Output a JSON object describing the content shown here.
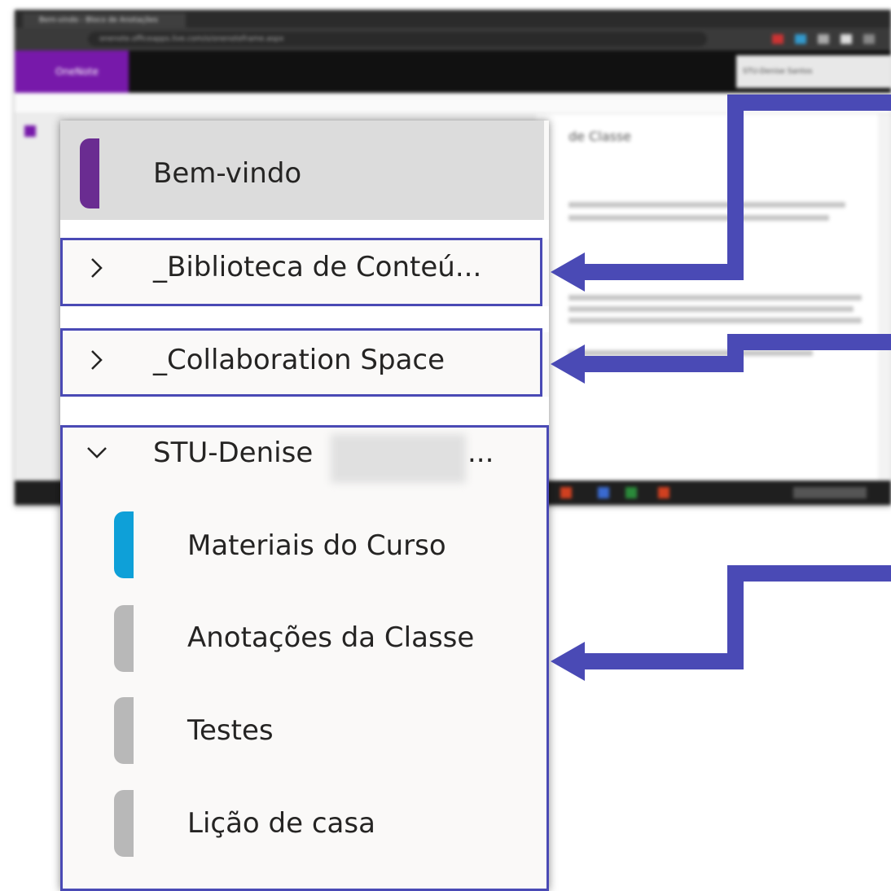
{
  "background": {
    "tab_title": "Bem-vindo - Bloco de Anotações",
    "url": "onenote.officeapps.live.com/o/onenoteframe.aspx",
    "app_name": "OneNote",
    "user": "STU-Denise Santos",
    "page_title": "de Classe"
  },
  "flyout": {
    "welcome_label": "Bem-vindo",
    "sections": [
      {
        "label": "_Biblioteca de Conteú...",
        "expanded": false,
        "chevron": "chevron-right-icon"
      },
      {
        "label": "_Collaboration Space",
        "expanded": false,
        "chevron": "chevron-right-icon"
      },
      {
        "label_prefix": "STU-Denise",
        "label_suffix": "...",
        "expanded": true,
        "chevron": "chevron-down-icon"
      }
    ],
    "student_pages": [
      {
        "label": "Materiais do Curso",
        "marker_color": "#0ea0d8"
      },
      {
        "label": "Anotações da Classe",
        "marker_color": "#b8b8b8"
      },
      {
        "label": "Testes",
        "marker_color": "#b8b8b8"
      },
      {
        "label": "Lição de casa",
        "marker_color": "#b8b8b8"
      }
    ]
  },
  "colors": {
    "accent_purple": "#6a2c91",
    "callout_blue": "#4a4ab5",
    "selected_bg": "#dcdcdc",
    "onenote_brand": "#7719aa"
  }
}
